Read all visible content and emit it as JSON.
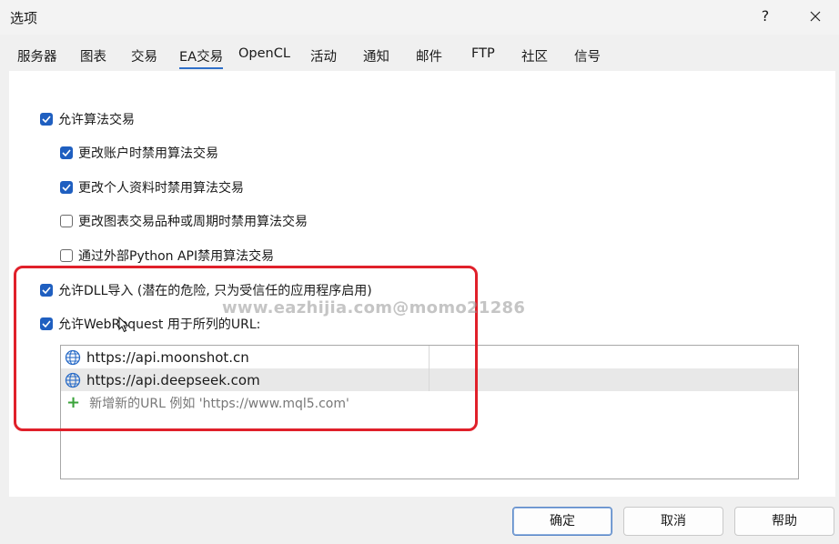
{
  "window": {
    "title": "选项",
    "help_glyph": "?"
  },
  "tabs": [
    {
      "label": "服务器"
    },
    {
      "label": "图表"
    },
    {
      "label": "交易"
    },
    {
      "label": "EA交易",
      "active": true
    },
    {
      "label": "OpenCL"
    },
    {
      "label": "活动"
    },
    {
      "label": "通知"
    },
    {
      "label": "邮件"
    },
    {
      "label": "FTP"
    },
    {
      "label": "社区"
    },
    {
      "label": "信号"
    }
  ],
  "options": {
    "allow_algo": {
      "label": "允许算法交易",
      "checked": true
    },
    "disable_on_account_change": {
      "label": "更改账户时禁用算法交易",
      "checked": true
    },
    "disable_on_profile_change": {
      "label": "更改个人资料时禁用算法交易",
      "checked": true
    },
    "disable_on_chart_change": {
      "label": "更改图表交易品种或周期时禁用算法交易",
      "checked": false
    },
    "disable_python_api": {
      "label": "通过外部Python API禁用算法交易",
      "checked": false
    },
    "allow_dll": {
      "label": "允许DLL导入 (潜在的危险, 只为受信任的应用程序启用)",
      "checked": true
    },
    "allow_webrequest": {
      "label": "允许WebRequest 用于所列的URL:",
      "checked": true
    }
  },
  "url_list": {
    "urls": [
      "https://api.moonshot.cn",
      "https://api.deepseek.com"
    ],
    "add_placeholder": "新增新的URL 例如 'https://www.mql5.com'"
  },
  "watermark": "www.eazhijia.com@momo21286",
  "buttons": {
    "ok": "确定",
    "cancel": "取消",
    "help": "帮助"
  },
  "colors": {
    "accent": "#1f5fc0",
    "highlight": "#e0202a",
    "add_plus": "#3ba33b"
  }
}
